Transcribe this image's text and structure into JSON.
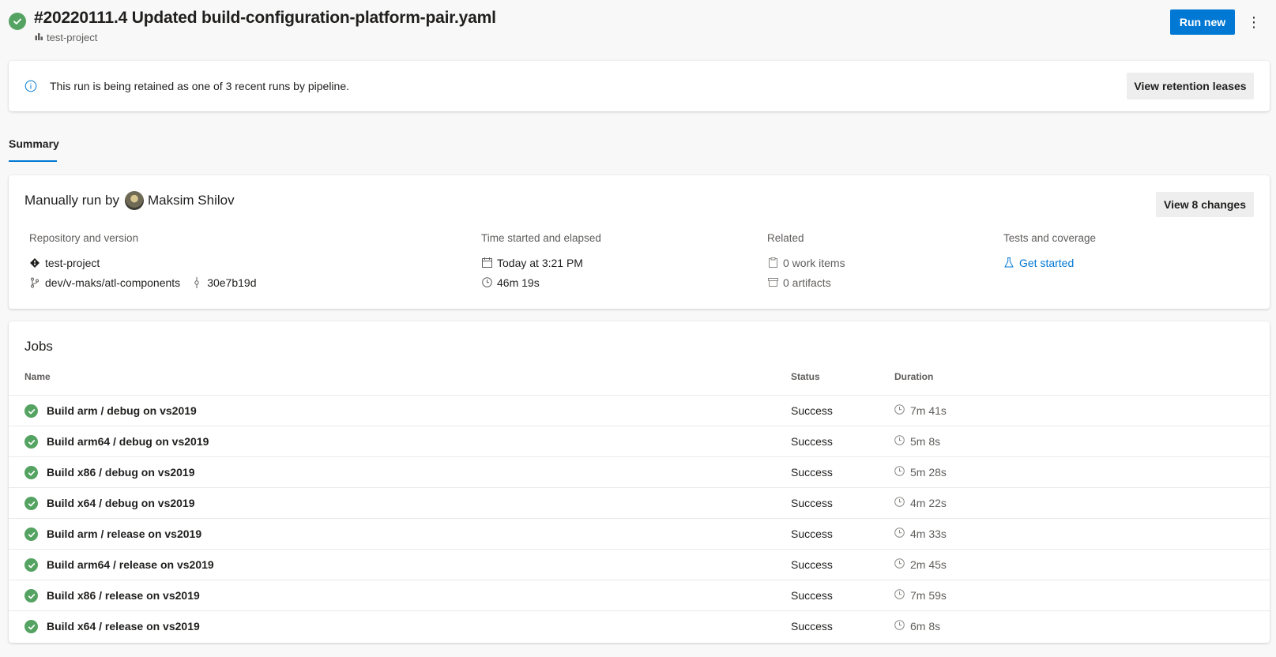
{
  "header": {
    "title": "#20220111.4 Updated build-configuration-platform-pair.yaml",
    "project": "test-project",
    "run_new_label": "Run new",
    "more_label": "⋮"
  },
  "banner": {
    "message": "This run is being retained as one of 3 recent runs by pipeline.",
    "button_label": "View retention leases"
  },
  "tabs": [
    {
      "label": "Summary",
      "selected": true
    }
  ],
  "summary": {
    "run_prefix": "Manually run by",
    "user_name": "Maksim Shilov",
    "view_changes_label": "View 8 changes",
    "repository": {
      "label": "Repository and version",
      "repo_name": "test-project",
      "branch": "dev/v-maks/atl-components",
      "commit": "30e7b19d"
    },
    "time": {
      "label": "Time started and elapsed",
      "started": "Today at 3:21 PM",
      "elapsed": "46m 19s"
    },
    "related": {
      "label": "Related",
      "work_items": "0 work items",
      "artifacts": "0 artifacts"
    },
    "tests": {
      "label": "Tests and coverage",
      "link": "Get started"
    }
  },
  "jobs": {
    "title": "Jobs",
    "columns": {
      "name": "Name",
      "status": "Status",
      "duration": "Duration"
    },
    "rows": [
      {
        "name": "Build arm / debug on vs2019",
        "status": "Success",
        "duration": "7m 41s"
      },
      {
        "name": "Build arm64 / debug on vs2019",
        "status": "Success",
        "duration": "5m 8s"
      },
      {
        "name": "Build x86 / debug on vs2019",
        "status": "Success",
        "duration": "5m 28s"
      },
      {
        "name": "Build x64 / debug on vs2019",
        "status": "Success",
        "duration": "4m 22s"
      },
      {
        "name": "Build arm / release on vs2019",
        "status": "Success",
        "duration": "4m 33s"
      },
      {
        "name": "Build arm64 / release on vs2019",
        "status": "Success",
        "duration": "2m 45s"
      },
      {
        "name": "Build x86 / release on vs2019",
        "status": "Success",
        "duration": "7m 59s"
      },
      {
        "name": "Build x64 / release on vs2019",
        "status": "Success",
        "duration": "6m 8s"
      }
    ]
  },
  "colors": {
    "accent": "#0078d4",
    "success": "#55a362",
    "text": "#201f1e",
    "muted": "#605e5c"
  }
}
